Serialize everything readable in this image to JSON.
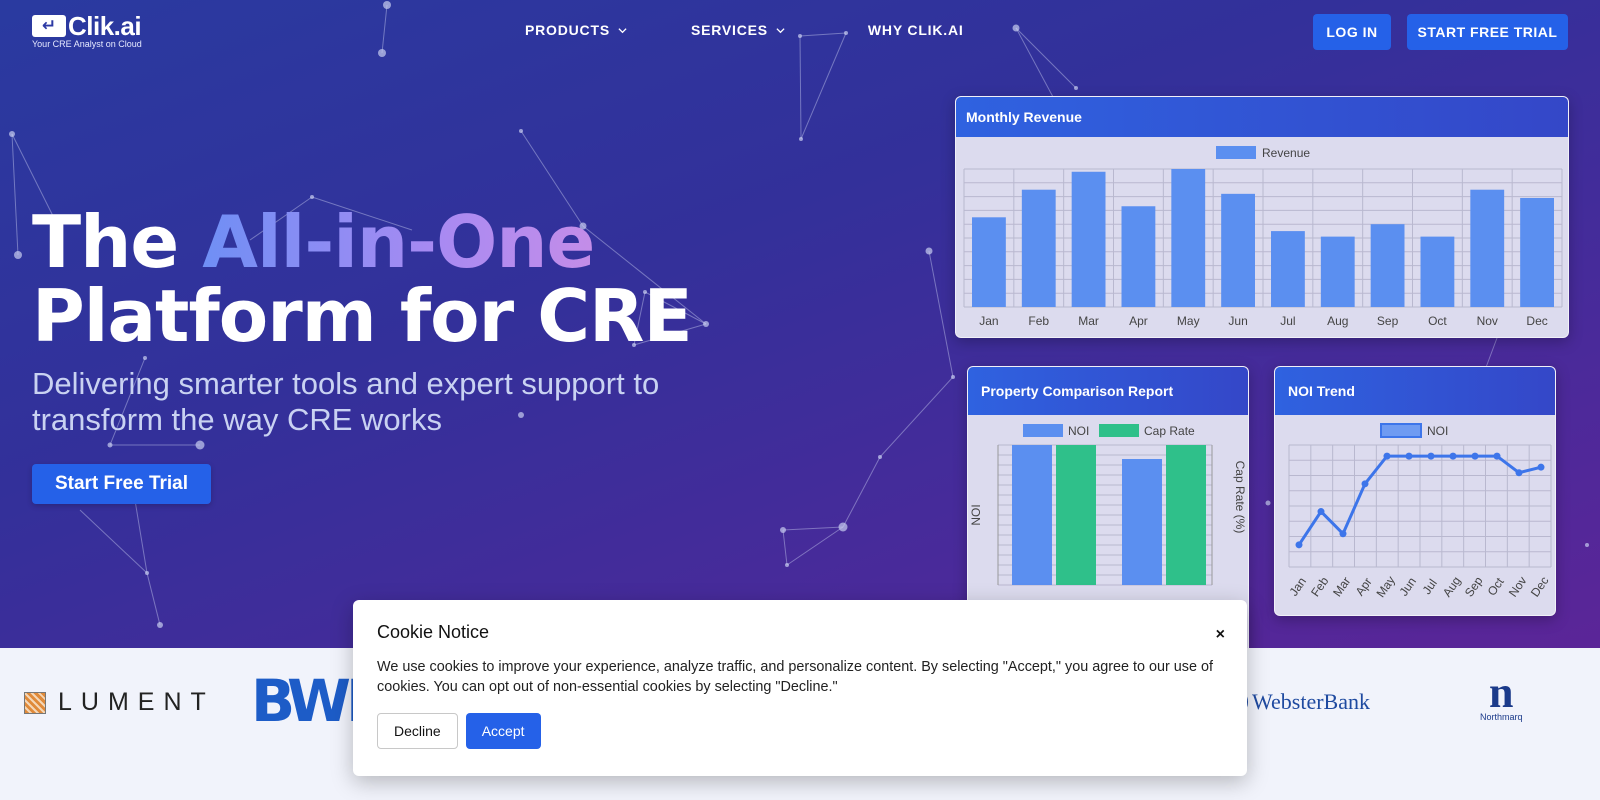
{
  "brand": {
    "logo_icon": "↵",
    "name": "Clik.ai",
    "tagline": "Your CRE Analyst on Cloud"
  },
  "nav": {
    "items": [
      {
        "label": "PRODUCTS",
        "has_dropdown": true
      },
      {
        "label": "SERVICES",
        "has_dropdown": true
      },
      {
        "label": "WHY CLIK.AI",
        "has_dropdown": false
      }
    ],
    "login_label": "LOG IN",
    "trial_label": "START FREE TRIAL"
  },
  "hero": {
    "headline_part1": "The ",
    "headline_highlight": "All-in-One",
    "headline_part2": "Platform for CRE",
    "subhead": "Delivering smarter tools and expert support to transform the way CRE works",
    "cta_label": "Start Free Trial"
  },
  "chart_data": [
    {
      "type": "bar",
      "title": "Monthly Revenue",
      "legend": [
        "Revenue"
      ],
      "categories": [
        "Jan",
        "Feb",
        "Mar",
        "Apr",
        "May",
        "Jun",
        "Jul",
        "Aug",
        "Sep",
        "Oct",
        "Nov",
        "Dec"
      ],
      "series": [
        {
          "name": "Revenue",
          "values": [
            65,
            85,
            98,
            73,
            100,
            82,
            55,
            51,
            60,
            51,
            85,
            79
          ]
        }
      ],
      "ylim": [
        0,
        100
      ],
      "grid": true,
      "colors": [
        "#5b8ff0"
      ]
    },
    {
      "type": "bar",
      "title": "Property Comparison Report",
      "legend": [
        "NOI",
        "Cap Rate"
      ],
      "ylabel": "NOI",
      "y2label": "Cap Rate (%)",
      "categories": [
        "A",
        "B"
      ],
      "series": [
        {
          "name": "NOI",
          "values": [
            100,
            90
          ]
        },
        {
          "name": "Cap Rate",
          "values": [
            100,
            100
          ]
        }
      ],
      "ylim": [
        0,
        100
      ],
      "grid": true,
      "colors": [
        "#5b8ff0",
        "#2fc08a"
      ]
    },
    {
      "type": "line",
      "title": "NOI Trend",
      "legend": [
        "NOI"
      ],
      "categories": [
        "Jan",
        "Feb",
        "Mar",
        "Apr",
        "May",
        "Jun",
        "Jul",
        "Aug",
        "Sep",
        "Oct",
        "Nov",
        "Dec"
      ],
      "series": [
        {
          "name": "NOI",
          "values": [
            20,
            50,
            30,
            75,
            100,
            100,
            100,
            100,
            100,
            100,
            85,
            90
          ]
        }
      ],
      "ylim": [
        0,
        110
      ],
      "grid": true,
      "colors": [
        "#3d75ea"
      ]
    }
  ],
  "logos": {
    "lument": "LUMENT",
    "bwe": "BWE",
    "webster": "WebsterBank",
    "northmarq_mark": "n",
    "northmarq_label": "Northmarq"
  },
  "cookie": {
    "title": "Cookie Notice",
    "close_icon": "×",
    "body": "We use cookies to improve your experience, analyze traffic, and personalize content. By selecting \"Accept,\" you agree to our use of cookies. You can opt out of non-essential cookies by selecting \"Decline.\"",
    "decline_label": "Decline",
    "accept_label": "Accept"
  }
}
